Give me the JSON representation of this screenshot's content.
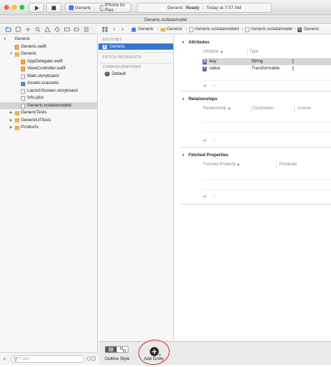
{
  "toolbar": {
    "run_icon": "play-icon",
    "stop_icon": "stop-icon",
    "scheme_name": "Generic",
    "scheme_separator": "〉",
    "destination": "iPhone 6s Plus",
    "status_app": "Generic:",
    "status_state": "Ready",
    "status_time": "Today at 7:57 AM"
  },
  "tab": {
    "title": "Generic.xcdatamodel"
  },
  "navigator": {
    "icons": [
      "folder-icon",
      "source-control-icon",
      "symbol-icon",
      "find-icon",
      "issue-icon",
      "test-icon",
      "debug-icon",
      "breakpoint-icon",
      "report-icon"
    ],
    "items": [
      {
        "label": "Generic",
        "kind": "project",
        "level": 0,
        "expanded": true
      },
      {
        "label": "Generic.swift",
        "kind": "swift",
        "level": 1
      },
      {
        "label": "Generic",
        "kind": "folder",
        "level": 1,
        "expanded": true
      },
      {
        "label": "AppDelegate.swift",
        "kind": "swift",
        "level": 2
      },
      {
        "label": "ViewController.swift",
        "kind": "swift",
        "level": 2
      },
      {
        "label": "Main.storyboard",
        "kind": "doc",
        "level": 2
      },
      {
        "label": "Assets.xcassets",
        "kind": "assets",
        "level": 2
      },
      {
        "label": "LaunchScreen.storyboard",
        "kind": "doc",
        "level": 2
      },
      {
        "label": "Info.plist",
        "kind": "doc",
        "level": 2
      },
      {
        "label": "Generic.xcdatamodeld",
        "kind": "doc",
        "level": 2,
        "selected": true
      },
      {
        "label": "GenericTests",
        "kind": "folder",
        "level": 1,
        "expanded": false
      },
      {
        "label": "GenericUITests",
        "kind": "folder",
        "level": 1,
        "expanded": false
      },
      {
        "label": "Products",
        "kind": "folder",
        "level": 1,
        "expanded": false
      }
    ],
    "filter_placeholder": "Filter"
  },
  "jumpbar": {
    "crumbs": [
      "Generic",
      "Generic",
      "Generic.xcdatamodeld",
      "Generic.xcdatamodel",
      "Generic"
    ]
  },
  "entity_list": {
    "entities_header": "ENTITIES",
    "entities": [
      "Generic"
    ],
    "fetch_header": "FETCH REQUESTS",
    "config_header": "CONFIGURATIONS",
    "configurations": [
      "Default"
    ]
  },
  "editor": {
    "attributes": {
      "title": "Attributes",
      "col_attribute": "Attribute",
      "col_type": "Type",
      "rows": [
        {
          "badge": "S",
          "name": "key",
          "type": "String",
          "selected": true
        },
        {
          "badge": "T",
          "name": "value",
          "type": "Transformable",
          "selected": false
        }
      ]
    },
    "relationships": {
      "title": "Relationships",
      "col_relationship": "Relationship",
      "col_destination": "Destination",
      "col_inverse": "Inverse"
    },
    "fetched": {
      "title": "Fetched Properties",
      "col_fetched": "Fetched Property",
      "col_predicate": "Predicate"
    },
    "plus": "+",
    "minus": "−"
  },
  "bottombar": {
    "outline_style_label": "Outline Style",
    "add_entity_label": "Add Entity"
  },
  "colors": {
    "selection_blue": "#3574d4",
    "annotation_red": "#e02020"
  }
}
